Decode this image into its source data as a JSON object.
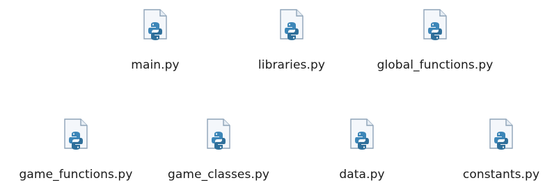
{
  "files": [
    {
      "name": "main.py",
      "icon": "python-file-icon"
    },
    {
      "name": "libraries.py",
      "icon": "python-file-icon"
    },
    {
      "name": "global_functions.py",
      "icon": "python-file-icon"
    },
    {
      "name": "game_functions.py",
      "icon": "python-file-icon"
    },
    {
      "name": "game_classes.py",
      "icon": "python-file-icon"
    },
    {
      "name": "data.py",
      "icon": "python-file-icon"
    },
    {
      "name": "constants.py",
      "icon": "python-file-icon"
    }
  ],
  "colors": {
    "page_bg": "#ffffff",
    "icon_page_fill": "#f4f7fb",
    "icon_page_border": "#8ea3b8",
    "python_blue": "#3c86b8",
    "python_dark": "#2f6f9a"
  }
}
